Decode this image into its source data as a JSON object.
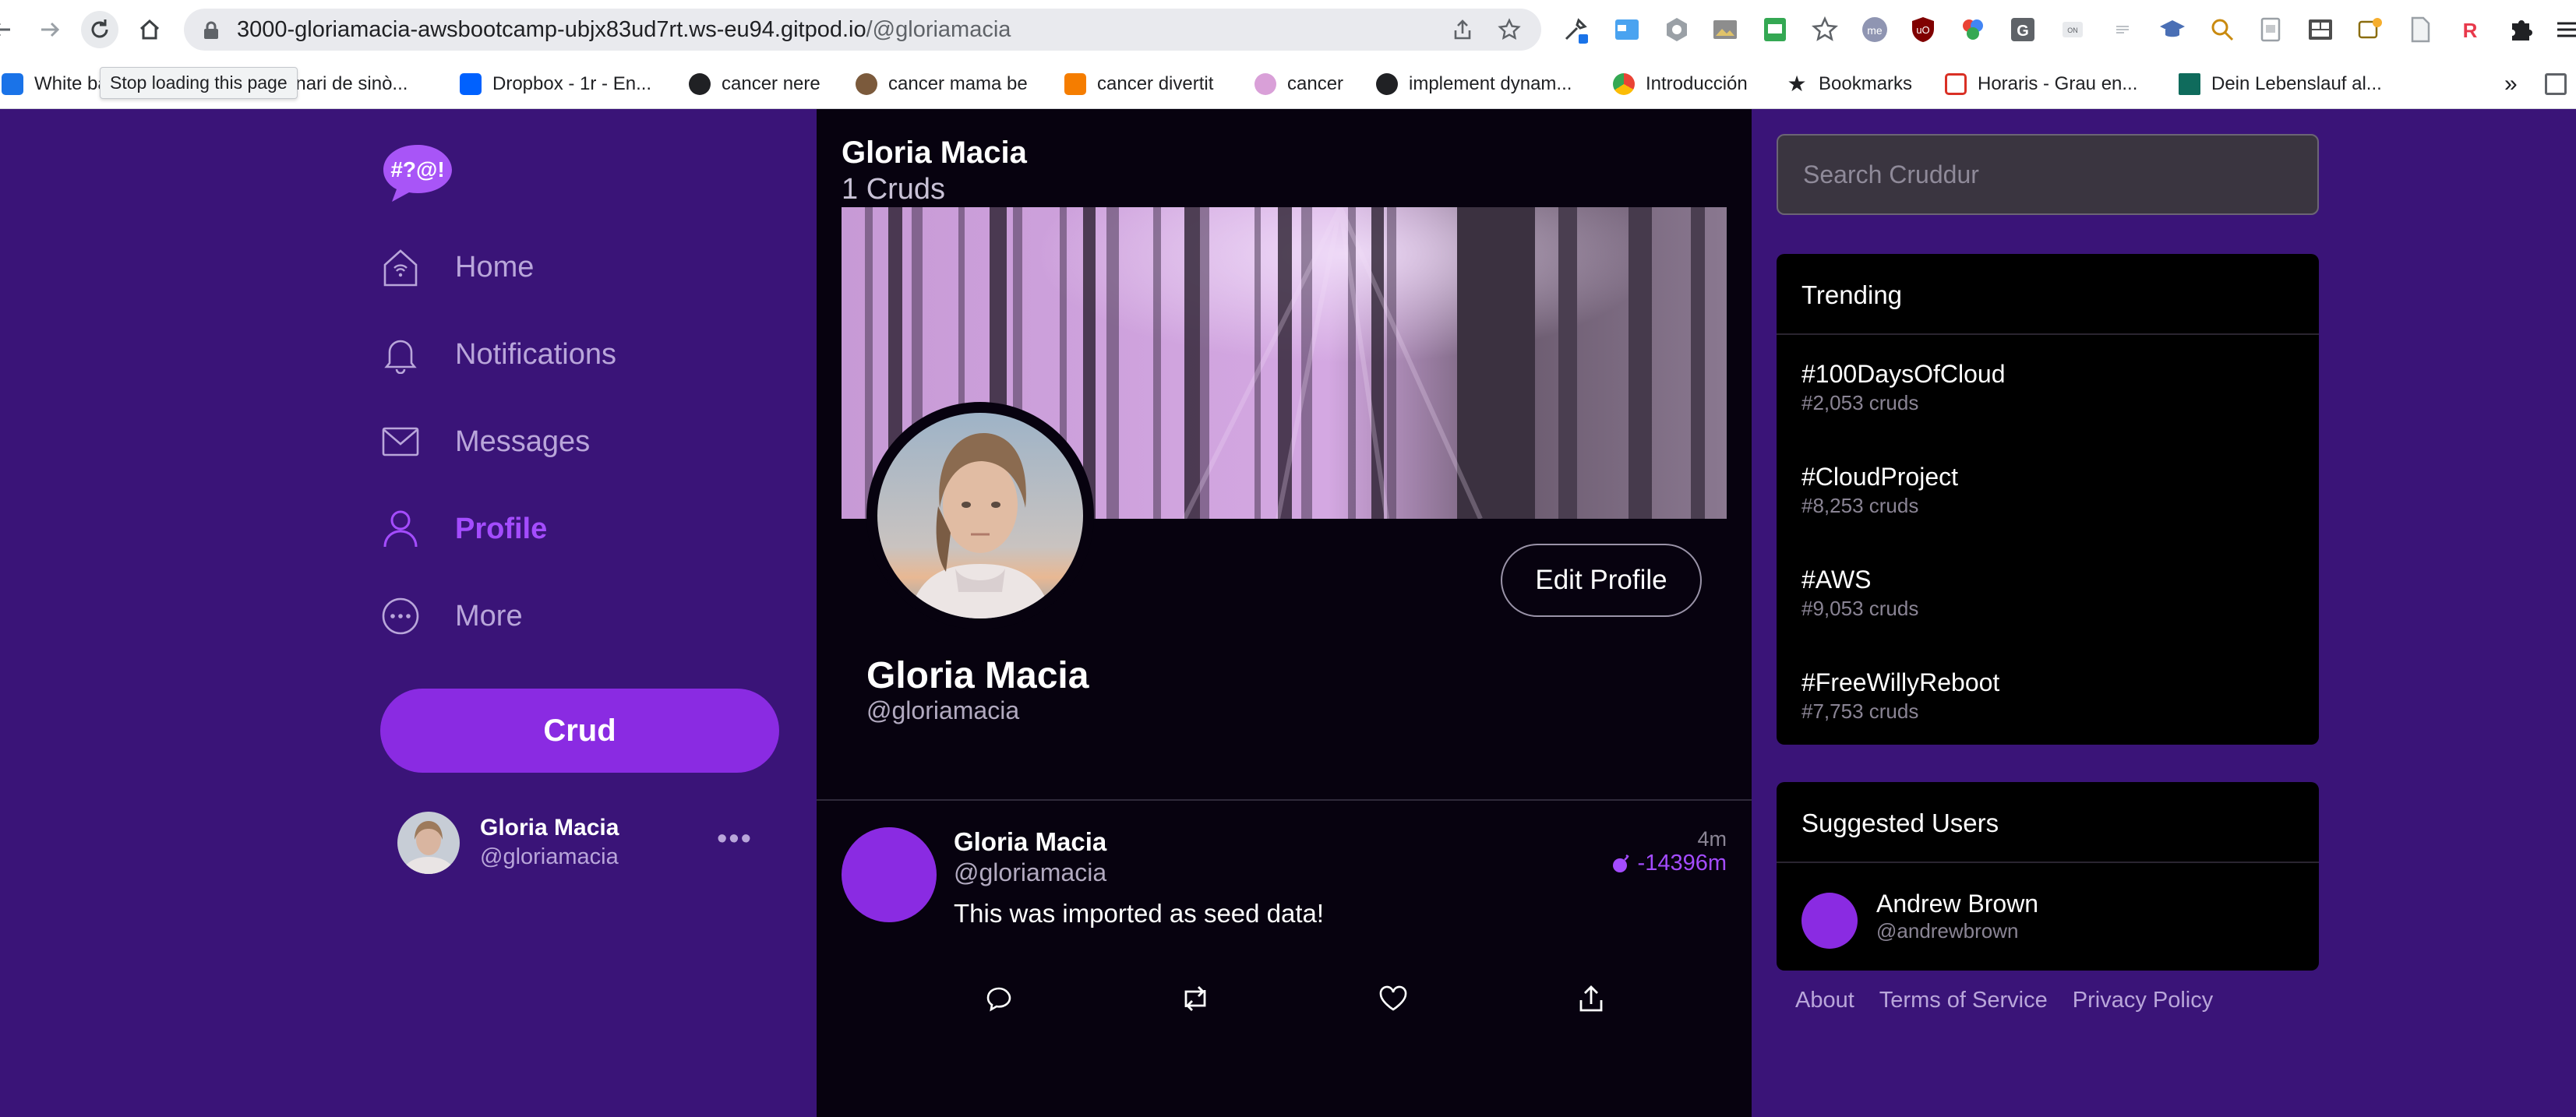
{
  "browser": {
    "url_host": "3000-gloriamacia-awsbootcamp-ubjx83ud7rt.ws-eu94.gitpod.io",
    "url_path": "/@gloriamacia",
    "tooltip": "Stop loading this page",
    "bookmarks": [
      {
        "label": "White ba",
        "icon": "doc-icon",
        "color": "#1a73e8"
      },
      {
        "label": "onari de sinò...",
        "icon": "doc-icon",
        "color": "#9aa0a6"
      },
      {
        "label": "Dropbox - 1r - En...",
        "icon": "dropbox-icon",
        "color": "#0061fe"
      },
      {
        "label": "cancer nere",
        "icon": "globe-icon",
        "color": "#202124"
      },
      {
        "label": "cancer mama be",
        "icon": "site-icon",
        "color": "#7b5a3c"
      },
      {
        "label": "cancer divertit",
        "icon": "blogger-icon",
        "color": "#f57d00"
      },
      {
        "label": "cancer",
        "icon": "site-icon",
        "color": "#d9a0d8"
      },
      {
        "label": "implement dynam...",
        "icon": "github-icon",
        "color": "#202124"
      },
      {
        "label": "Introducción",
        "icon": "chrome-icon",
        "color": "#34a853"
      },
      {
        "label": "Bookmarks",
        "icon": "star-icon",
        "color": "#202124"
      },
      {
        "label": "Horaris - Grau en...",
        "icon": "site-icon",
        "color": "#d93025"
      },
      {
        "label": "Dein Lebenslauf al...",
        "icon": "bookmark-icon",
        "color": "#0f6b5c"
      }
    ],
    "overflow": "»"
  },
  "app": {
    "colors": {
      "bg": "#3a1478",
      "accent": "#8a2be2",
      "feed": "#07020f"
    },
    "logo_text": "#?@!",
    "nav": [
      {
        "label": "Home",
        "icon": "home-icon",
        "active": false
      },
      {
        "label": "Notifications",
        "icon": "bell-icon",
        "active": false
      },
      {
        "label": "Messages",
        "icon": "envelope-icon",
        "active": false
      },
      {
        "label": "Profile",
        "icon": "user-icon",
        "active": true
      },
      {
        "label": "More",
        "icon": "more-icon",
        "active": false
      }
    ],
    "crud_button": "Crud",
    "current_user": {
      "name": "Gloria Macia",
      "handle": "@gloriamacia",
      "more": "•••"
    }
  },
  "profile": {
    "header_name": "Gloria Macia",
    "header_count": "1 Cruds",
    "name": "Gloria Macia",
    "handle": "@gloriamacia",
    "edit_button": "Edit Profile"
  },
  "post": {
    "name": "Gloria Macia",
    "handle": "@gloriamacia",
    "time": "4m",
    "expires": "-14396m",
    "text": "This was imported as seed data!",
    "actions": [
      "reply-icon",
      "repost-icon",
      "like-icon",
      "share-icon"
    ]
  },
  "search": {
    "placeholder": "Search Cruddur"
  },
  "trending": {
    "title": "Trending",
    "items": [
      {
        "tag": "#100DaysOfCloud",
        "count": "#2,053 cruds"
      },
      {
        "tag": "#CloudProject",
        "count": "#8,253 cruds"
      },
      {
        "tag": "#AWS",
        "count": "#9,053 cruds"
      },
      {
        "tag": "#FreeWillyReboot",
        "count": "#7,753 cruds"
      }
    ]
  },
  "suggested": {
    "title": "Suggested Users",
    "users": [
      {
        "name": "Andrew Brown",
        "handle": "@andrewbrown"
      }
    ]
  },
  "footer": [
    "About",
    "Terms of Service",
    "Privacy Policy"
  ]
}
